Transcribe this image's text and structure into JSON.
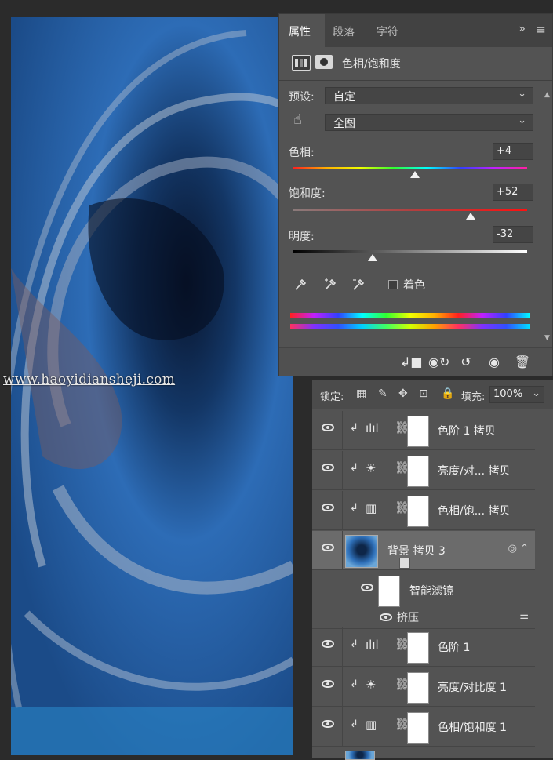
{
  "watermark": "www.haoyidiansheji.com",
  "properties": {
    "tabs": [
      "属性",
      "段落",
      "字符"
    ],
    "collapse_glyph": "»",
    "menu_glyph": "≡",
    "title": "色相/饱和度",
    "preset_label": "预设:",
    "preset_value": "自定",
    "range_value": "全图",
    "hue": {
      "label": "色相:",
      "value": "+4",
      "level": 0.52
    },
    "saturation": {
      "label": "饱和度:",
      "value": "+52",
      "level": 0.76
    },
    "lightness": {
      "label": "明度:",
      "value": "-32",
      "level": 0.34
    },
    "colorize_label": "着色",
    "colorize_checked": false
  },
  "layers": {
    "lock_label": "锁定:",
    "fill_label": "填充:",
    "fill_value": "100%",
    "items": [
      {
        "name": "色阶 1 拷贝",
        "icon": "levels-icon"
      },
      {
        "name": "亮度/对... 拷贝",
        "icon": "brightness-icon"
      },
      {
        "name": "色相/饱... 拷贝",
        "icon": "hue-saturation-icon"
      },
      {
        "name": "背景 拷贝 3",
        "icon": "smart-object",
        "selected": true
      },
      {
        "name": "智能滤镜",
        "icon": "smart-filter"
      },
      {
        "name": "挤压",
        "icon": "filter"
      },
      {
        "name": "色阶 1",
        "icon": "levels-icon"
      },
      {
        "name": "亮度/对比度 1",
        "icon": "brightness-icon"
      },
      {
        "name": "色相/饱和度 1",
        "icon": "hue-saturation-icon"
      }
    ]
  }
}
